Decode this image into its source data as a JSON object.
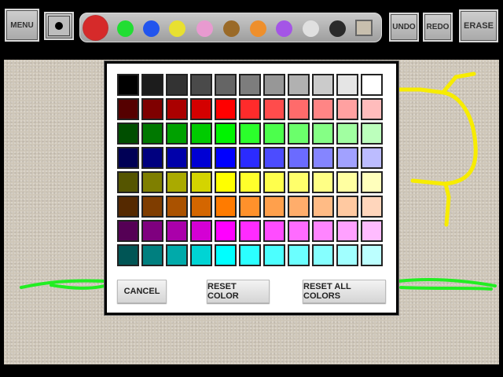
{
  "toolbar": {
    "menu_label": "MENU",
    "undo_label": "UNDO",
    "redo_label": "REDO",
    "erase_label": "ERASE",
    "brush_icon": "brush-size-dot-icon",
    "palette": [
      {
        "color": "#d62a2a",
        "selected": true
      },
      {
        "color": "#22dd33",
        "selected": false
      },
      {
        "color": "#2255ee",
        "selected": false
      },
      {
        "color": "#e8e030",
        "selected": false
      },
      {
        "color": "#e89ad0",
        "selected": false
      },
      {
        "color": "#9a6a28",
        "selected": false
      },
      {
        "color": "#ee8f2c",
        "selected": false
      },
      {
        "color": "#a455e6",
        "selected": false
      },
      {
        "color": "#e0e0e0",
        "selected": false
      },
      {
        "color": "#2a2a2a",
        "selected": false
      }
    ],
    "custom_swatch_color": "#c8bfae"
  },
  "canvas": {
    "background": "#cec6b8",
    "stroke_colors": [
      "#f7ec00",
      "#22ee22"
    ]
  },
  "color_picker": {
    "rows": [
      [
        "#000000",
        "#1c1c1c",
        "#333333",
        "#4a4a4a",
        "#656565",
        "#7d7d7d",
        "#979797",
        "#b1b1b1",
        "#cbcbcb",
        "#e5e5e5",
        "#ffffff"
      ],
      [
        "#550000",
        "#7f0000",
        "#aa0000",
        "#d40000",
        "#ff0000",
        "#ff2b2b",
        "#ff4c4c",
        "#ff6b6b",
        "#ff8585",
        "#ffa1a1",
        "#ffbcbc"
      ],
      [
        "#004e00",
        "#007800",
        "#00a100",
        "#00cb00",
        "#00f400",
        "#2bff2b",
        "#4cff4c",
        "#6bff6b",
        "#85ff85",
        "#a1ffa1",
        "#bcffbc"
      ],
      [
        "#000055",
        "#00007f",
        "#0000aa",
        "#0000d4",
        "#0000ff",
        "#2b2bff",
        "#4c4cff",
        "#6b6bff",
        "#8585ff",
        "#a1a1ff",
        "#bcbcff"
      ],
      [
        "#555500",
        "#7f7f00",
        "#aaaa00",
        "#d4d400",
        "#ffff00",
        "#ffff2b",
        "#ffff4c",
        "#ffff6b",
        "#ffff85",
        "#ffffa1",
        "#ffffbc"
      ],
      [
        "#552900",
        "#7f3d00",
        "#aa5200",
        "#d46600",
        "#ff7b00",
        "#ff912b",
        "#ffa04c",
        "#ffad6b",
        "#ffbb85",
        "#ffc9a1",
        "#ffd6bc"
      ],
      [
        "#550055",
        "#7f007f",
        "#aa00aa",
        "#d400d4",
        "#ff00ff",
        "#ff2bff",
        "#ff4cff",
        "#ff6bff",
        "#ff85ff",
        "#ffa1ff",
        "#ffbcff"
      ],
      [
        "#005555",
        "#007f7f",
        "#00aaaa",
        "#00d4d4",
        "#00ffff",
        "#2bffff",
        "#4cffff",
        "#6bffff",
        "#85ffff",
        "#a1ffff",
        "#bcffff"
      ]
    ],
    "cancel_label": "CANCEL",
    "reset_color_label": "RESET COLOR",
    "reset_all_label": "RESET ALL COLORS"
  }
}
